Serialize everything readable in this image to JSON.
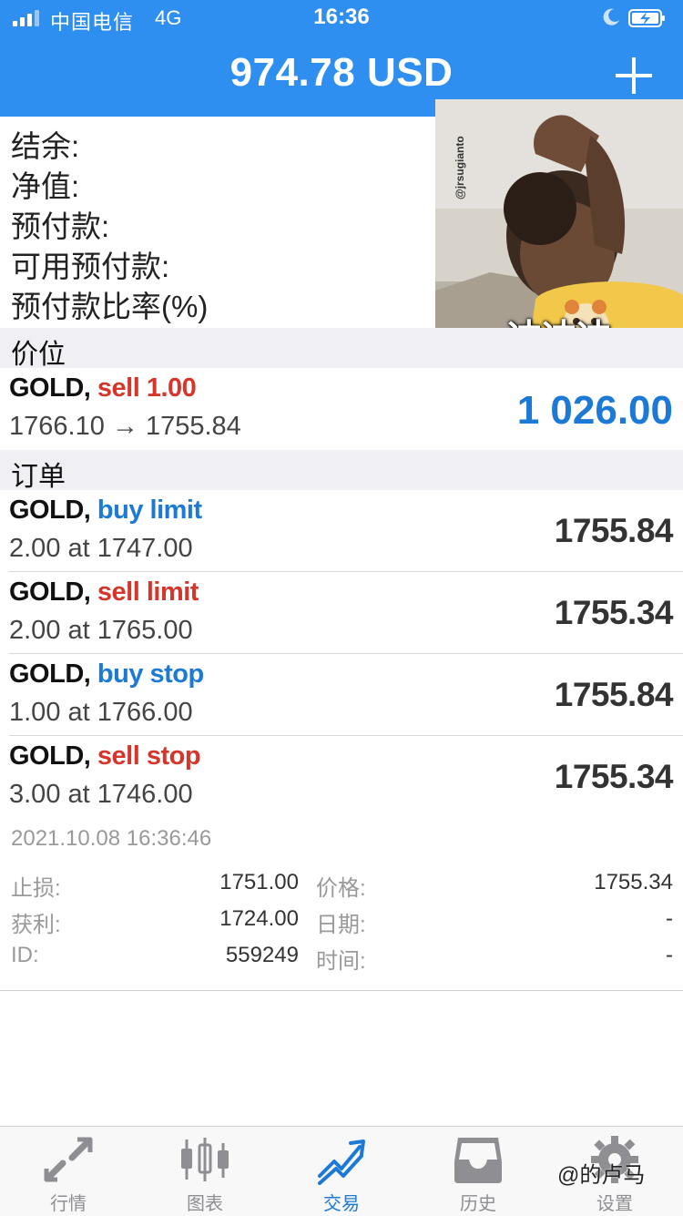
{
  "status_bar": {
    "carrier": "中国电信",
    "network": "4G",
    "time": "16:36"
  },
  "header": {
    "title": "974.78 USD",
    "add_icon": "plus-icon"
  },
  "account": {
    "labels": [
      "结余:",
      "净值:",
      "预付款:",
      "可用预付款:",
      "预付款比率(%)"
    ]
  },
  "meme": {
    "caption": "冲冲冲",
    "watermark": "@jrsugianto"
  },
  "positions_section": {
    "title": "价位",
    "rows": [
      {
        "symbol": "GOLD,",
        "side": "sell 1.00",
        "side_color": "#d5352a",
        "detail": "1766.10 → 1755.84",
        "profit": "1 026.00"
      }
    ]
  },
  "orders_section": {
    "title": "订单",
    "rows": [
      {
        "symbol": "GOLD,",
        "side": "buy limit",
        "side_color": "#1c7ad6",
        "detail": "2.00 at 1747.00",
        "price": "1755.84"
      },
      {
        "symbol": "GOLD,",
        "side": "sell limit",
        "side_color": "#d5352a",
        "detail": "2.00 at 1765.00",
        "price": "1755.34"
      },
      {
        "symbol": "GOLD,",
        "side": "buy stop",
        "side_color": "#1c7ad6",
        "detail": "1.00 at 1766.00",
        "price": "1755.84"
      },
      {
        "symbol": "GOLD,",
        "side": "sell stop",
        "side_color": "#d5352a",
        "detail": "3.00 at 1746.00",
        "price": "1755.34"
      }
    ]
  },
  "order_details": {
    "timestamp": "2021.10.08 16:36:46",
    "sl_label": "止损:",
    "sl_value": "1751.00",
    "tp_label": "获利:",
    "tp_value": "1724.00",
    "id_label": "ID:",
    "id_value": "559249",
    "price_label": "价格:",
    "price_value": "1755.34",
    "date_label": "日期:",
    "date_value": "-",
    "time_label": "时间:",
    "time_value": "-"
  },
  "tabbar": {
    "tabs": [
      {
        "label": "行情",
        "icon": "quotes-icon"
      },
      {
        "label": "图表",
        "icon": "candlestick-chart-icon"
      },
      {
        "label": "交易",
        "icon": "trade-trend-icon"
      },
      {
        "label": "历史",
        "icon": "history-inbox-icon"
      },
      {
        "label": "设置",
        "icon": "gear-icon"
      }
    ],
    "active_index": 2,
    "watermark": "@的卢马"
  },
  "colors": {
    "header_blue": "#2f8ff0",
    "sell_red": "#d5352a",
    "buy_blue": "#1c7ad6",
    "section_bg": "#efeff4"
  }
}
